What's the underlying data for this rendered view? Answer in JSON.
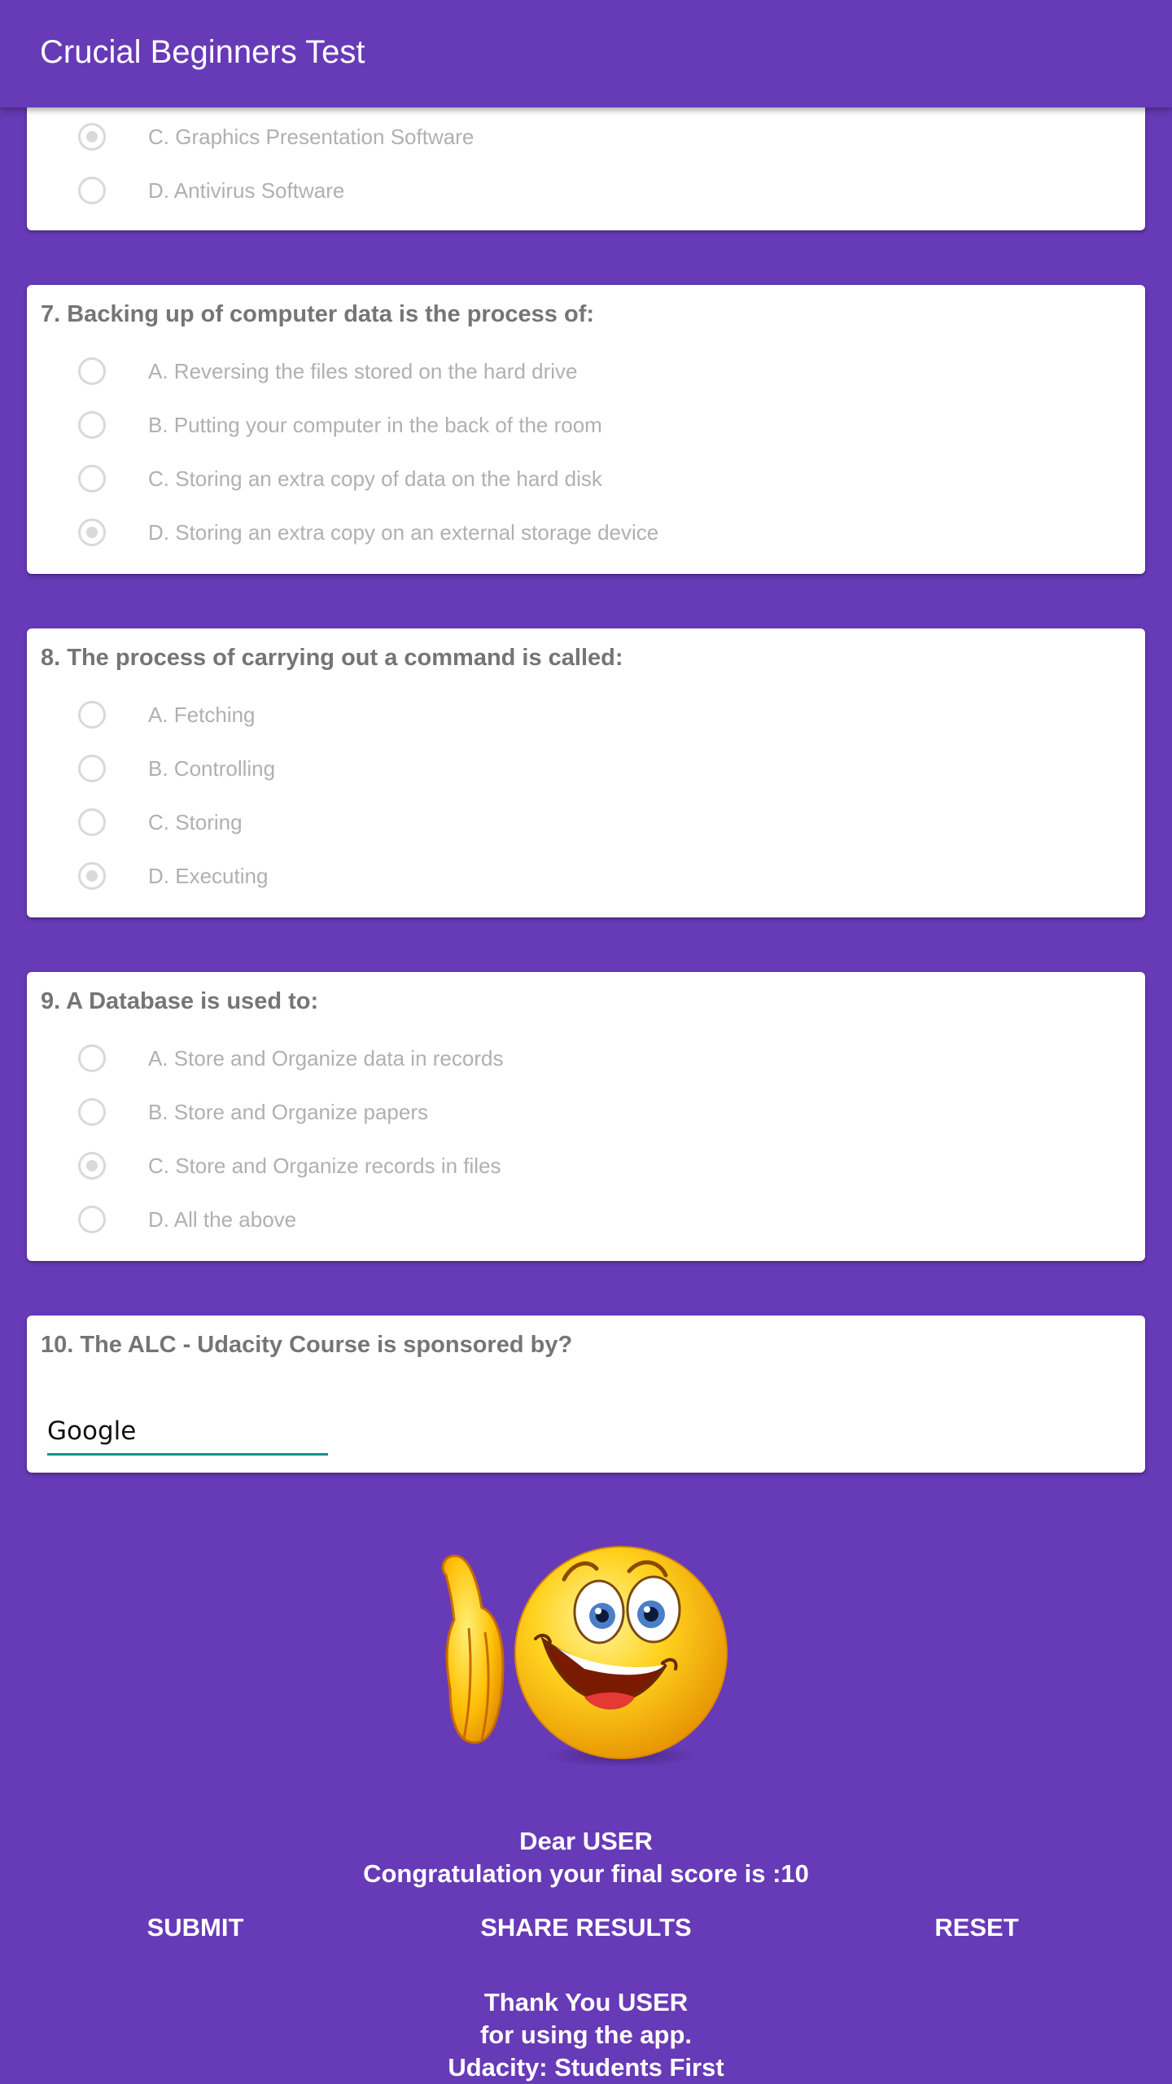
{
  "app": {
    "title": "Crucial Beginners Test"
  },
  "questions": [
    {
      "label": "",
      "options": [
        {
          "text": "C. Graphics Presentation Software",
          "selected": true
        },
        {
          "text": "D. Antivirus Software",
          "selected": false
        }
      ]
    },
    {
      "label": "7. Backing up of computer data is the process of:",
      "options": [
        {
          "text": "A. Reversing the files stored on the hard drive",
          "selected": false
        },
        {
          "text": "B. Putting your computer in the back of the room",
          "selected": false
        },
        {
          "text": "C. Storing an extra copy of data on the hard disk",
          "selected": false
        },
        {
          "text": "D. Storing an extra copy on an external storage device",
          "selected": true
        }
      ]
    },
    {
      "label": "8. The process of carrying out a command is called:",
      "options": [
        {
          "text": "A. Fetching",
          "selected": false
        },
        {
          "text": "B. Controlling",
          "selected": false
        },
        {
          "text": "C. Storing",
          "selected": false
        },
        {
          "text": "D. Executing",
          "selected": true
        }
      ]
    },
    {
      "label": "9. A Database is used to:",
      "options": [
        {
          "text": "A. Store and Organize data in records",
          "selected": false
        },
        {
          "text": "B. Store and Organize papers",
          "selected": false
        },
        {
          "text": "C. Store and Organize records in files",
          "selected": true
        },
        {
          "text": "D. All the above",
          "selected": false
        }
      ]
    },
    {
      "label": "10. The ALC - Udacity Course is sponsored by?",
      "answer_value": "Google"
    }
  ],
  "result": {
    "greeting": "Dear USER",
    "score_message": "Congratulation your final score is :10"
  },
  "actions": {
    "submit": "SUBMIT",
    "share": "SHARE RESULTS",
    "reset": "RESET"
  },
  "footer": {
    "line1": "Thank You USER",
    "line2": "for using the app.",
    "line3": "Udacity: Students First"
  },
  "colors": {
    "primary": "#673AB7",
    "accent": "#009688",
    "radio_inactive": "#d9d9d9"
  },
  "icons": {
    "illustration": "thumbs-up-smiley-emoji"
  }
}
